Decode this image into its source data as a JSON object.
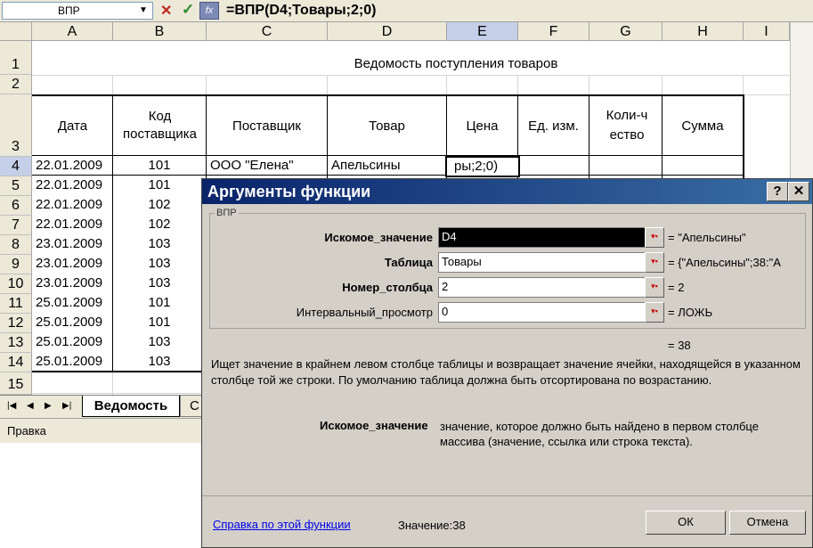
{
  "formula_bar": {
    "name_box": "ВПР",
    "formula": "=ВПР(D4;Товары;2;0)",
    "fx_label": "fx"
  },
  "sheet": {
    "columns": [
      "A",
      "B",
      "C",
      "D",
      "E",
      "F",
      "G",
      "H",
      "I"
    ],
    "selected_column": "E",
    "selected_row": "4",
    "title": "Ведомость поступления товаров",
    "headers": [
      "Дата",
      "Код поставщика",
      "Поставщик",
      "Товар",
      "Цена",
      "Ед. изм.",
      "Коли-чество",
      "Сумма"
    ],
    "rows": [
      {
        "num": "4",
        "date": "22.01.2009",
        "code": "101",
        "supplier": "ООО \"Елена\"",
        "product": "Апельсины",
        "price": "ры;2;0)"
      },
      {
        "num": "5",
        "date": "22.01.2009",
        "code": "101"
      },
      {
        "num": "6",
        "date": "22.01.2009",
        "code": "102"
      },
      {
        "num": "7",
        "date": "22.01.2009",
        "code": "102"
      },
      {
        "num": "8",
        "date": "23.01.2009",
        "code": "103"
      },
      {
        "num": "9",
        "date": "23.01.2009",
        "code": "103"
      },
      {
        "num": "10",
        "date": "23.01.2009",
        "code": "103"
      },
      {
        "num": "11",
        "date": "25.01.2009",
        "code": "101"
      },
      {
        "num": "12",
        "date": "25.01.2009",
        "code": "101"
      },
      {
        "num": "13",
        "date": "25.01.2009",
        "code": "103"
      },
      {
        "num": "14",
        "date": "25.01.2009",
        "code": "103"
      }
    ],
    "row_numbers_top": [
      "1",
      "2",
      "3"
    ],
    "row_15": "15",
    "tabs": {
      "active": "Ведомость",
      "next": "С"
    },
    "status": "Правка"
  },
  "dialog": {
    "title": "Аргументы функции",
    "help_btn": "?",
    "close_btn": "✕",
    "group_label": "ВПР",
    "args": [
      {
        "label": "Искомое_значение",
        "value": "D4",
        "result": "= \"Апельсины\"",
        "bold": true
      },
      {
        "label": "Таблица",
        "value": "Товары",
        "result": "= {\"Апельсины\";38:\"А",
        "bold": true
      },
      {
        "label": "Номер_столбца",
        "value": "2",
        "result": "= 2",
        "bold": true
      },
      {
        "label": "Интервальный_просмотр",
        "value": "0",
        "result": "= ЛОЖЬ",
        "bold": false
      }
    ],
    "total_result": "= 38",
    "description": "Ищет значение в крайнем левом столбце таблицы и возвращает значение ячейки, находящейся в указанном столбце той же строки. По умолчанию таблица должна быть отсортирована по возрастанию.",
    "arg_help_label": "Искомое_значение",
    "arg_help_text": "значение, которое должно быть найдено в первом столбце массива (значение, ссылка или строка текста).",
    "help_link": "Справка по этой функции",
    "value_line": "Значение:38",
    "ok": "ОК",
    "cancel": "Отмена"
  }
}
